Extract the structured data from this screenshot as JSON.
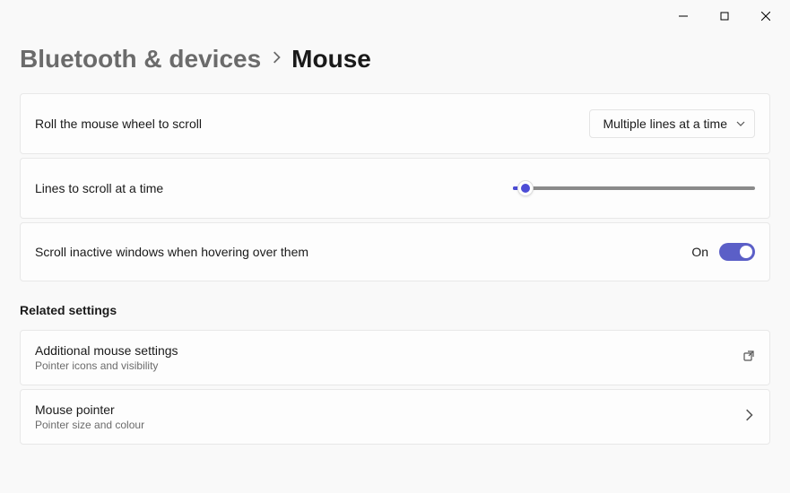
{
  "window": {
    "minimize": "minimize",
    "maximize": "maximize",
    "close": "close"
  },
  "breadcrumb": {
    "parent": "Bluetooth & devices",
    "current": "Mouse"
  },
  "settings": {
    "scroll_mode": {
      "label": "Roll the mouse wheel to scroll",
      "value": "Multiple lines at a time"
    },
    "lines_to_scroll": {
      "label": "Lines to scroll at a time",
      "value": 3,
      "min": 1,
      "max": 100
    },
    "scroll_inactive": {
      "label": "Scroll inactive windows when hovering over them",
      "state_text": "On",
      "enabled": true
    }
  },
  "related": {
    "heading": "Related settings",
    "items": [
      {
        "title": "Additional mouse settings",
        "subtitle": "Pointer icons and visibility",
        "action": "external"
      },
      {
        "title": "Mouse pointer",
        "subtitle": "Pointer size and colour",
        "action": "navigate"
      }
    ]
  }
}
